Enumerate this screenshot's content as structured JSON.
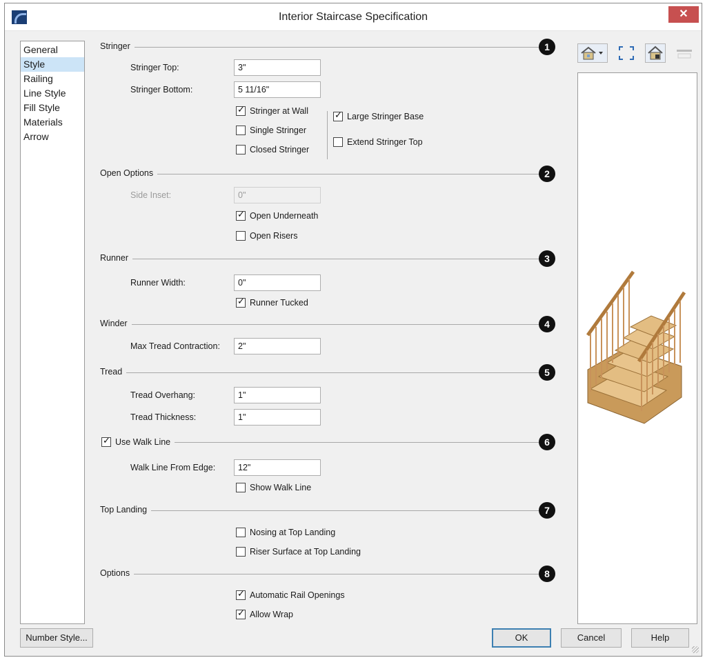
{
  "window": {
    "title": "Interior Staircase Specification",
    "close_glyph": "✕"
  },
  "nav": {
    "items": [
      {
        "label": "General"
      },
      {
        "label": "Style"
      },
      {
        "label": "Railing"
      },
      {
        "label": "Line Style"
      },
      {
        "label": "Fill Style"
      },
      {
        "label": "Materials"
      },
      {
        "label": "Arrow"
      }
    ],
    "selected": "Style"
  },
  "stringer": {
    "title": "Stringer",
    "badge": "1",
    "top_label": "Stringer Top:",
    "top_value": "3\"",
    "bottom_label": "Stringer Bottom:",
    "bottom_value": "5 11/16\"",
    "at_wall": {
      "label": "Stringer at Wall",
      "checked": true
    },
    "single": {
      "label": "Single Stringer",
      "checked": false
    },
    "closed": {
      "label": "Closed Stringer",
      "checked": false
    },
    "large_base": {
      "label": "Large Stringer Base",
      "checked": true
    },
    "extend_top": {
      "label": "Extend Stringer Top",
      "checked": false
    }
  },
  "open_options": {
    "title": "Open Options",
    "badge": "2",
    "side_inset_label": "Side Inset:",
    "side_inset_value": "0\"",
    "open_underneath": {
      "label": "Open Underneath",
      "checked": true
    },
    "open_risers": {
      "label": "Open Risers",
      "checked": false
    }
  },
  "runner": {
    "title": "Runner",
    "badge": "3",
    "width_label": "Runner Width:",
    "width_value": "0\"",
    "tucked": {
      "label": "Runner Tucked",
      "checked": true
    }
  },
  "winder": {
    "title": "Winder",
    "badge": "4",
    "max_label": "Max Tread Contraction:",
    "max_value": "2\""
  },
  "tread": {
    "title": "Tread",
    "badge": "5",
    "overhang_label": "Tread Overhang:",
    "overhang_value": "1\"",
    "thickness_label": "Tread Thickness:",
    "thickness_value": "1\""
  },
  "walk_line": {
    "use": {
      "label": "Use Walk Line",
      "checked": true
    },
    "badge": "6",
    "from_edge_label": "Walk Line From Edge:",
    "from_edge_value": "12\"",
    "show": {
      "label": "Show Walk Line",
      "checked": false
    }
  },
  "top_landing": {
    "title": "Top Landing",
    "badge": "7",
    "nosing": {
      "label": "Nosing at Top Landing",
      "checked": false
    },
    "riser_surface": {
      "label": "Riser Surface at Top Landing",
      "checked": false
    }
  },
  "options": {
    "title": "Options",
    "badge": "8",
    "auto_rail": {
      "label": "Automatic Rail Openings",
      "checked": true
    },
    "allow_wrap": {
      "label": "Allow Wrap",
      "checked": true
    }
  },
  "preview_toolbar": {
    "icons": [
      "view-render-icon",
      "fill-window-icon",
      "color-preview-icon",
      "disabled-tool-icon"
    ]
  },
  "footer": {
    "number_style": "Number Style...",
    "ok": "OK",
    "cancel": "Cancel",
    "help": "Help"
  },
  "colors": {
    "selection": "#cce4f7",
    "close": "#c75050",
    "wood": "#d9a86c"
  }
}
